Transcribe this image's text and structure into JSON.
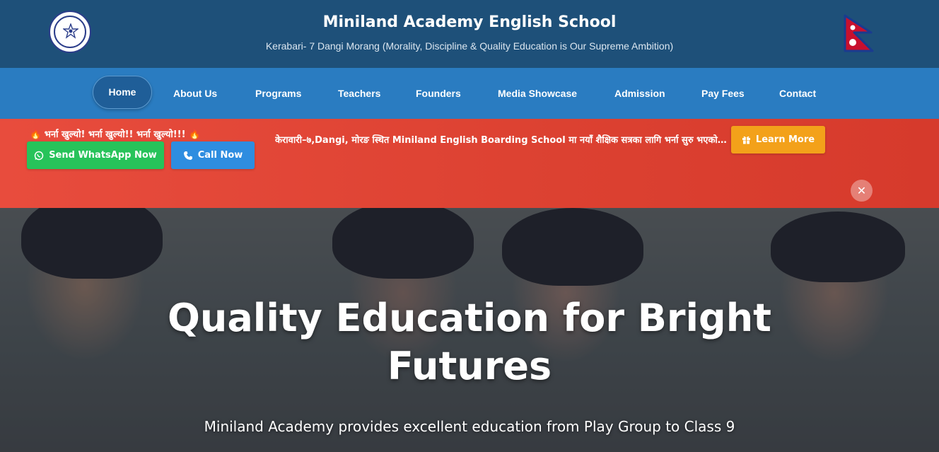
{
  "header": {
    "title": "Miniland Academy English School",
    "tagline": "Kerabari- 7 Dangi Morang (Morality, Discipline & Quality Education is Our Supreme Ambition)",
    "logo_icon": "school-emblem-icon",
    "flag_icon": "nepal-flag-icon"
  },
  "nav": {
    "items": [
      {
        "label": "Home",
        "active": true
      },
      {
        "label": "About Us"
      },
      {
        "label": "Programs"
      },
      {
        "label": "Teachers"
      },
      {
        "label": "Founders"
      },
      {
        "label": "Media Showcase"
      },
      {
        "label": "Admission"
      },
      {
        "label": "Pay Fees"
      },
      {
        "label": "Contact"
      }
    ]
  },
  "banner": {
    "headline": "भर्ना खुल्यो! भर्ना खुल्यो!! भर्ना खुल्यो!!!",
    "whatsapp_label": "Send WhatsApp Now",
    "call_label": "Call Now",
    "ticker": "केरावारी–७,Dangi, मोरङ स्थित Miniland English Boarding School मा नयाँ शैक्षिक सत्रका लागि भर्ना सुरु भएको छ।",
    "learn_more_label": "Learn More",
    "close_glyph": "✕"
  },
  "hero": {
    "title": "Quality Education for Bright Futures",
    "subtitle": "Miniland Academy provides excellent education from Play Group to Class 9"
  },
  "colors": {
    "header_bg": "#1e5079",
    "nav_bg": "#2a7cc1",
    "banner_bg": "#e04535",
    "whatsapp": "#27c35a",
    "call": "#2e8de0",
    "learn_more": "#f3a11a"
  }
}
